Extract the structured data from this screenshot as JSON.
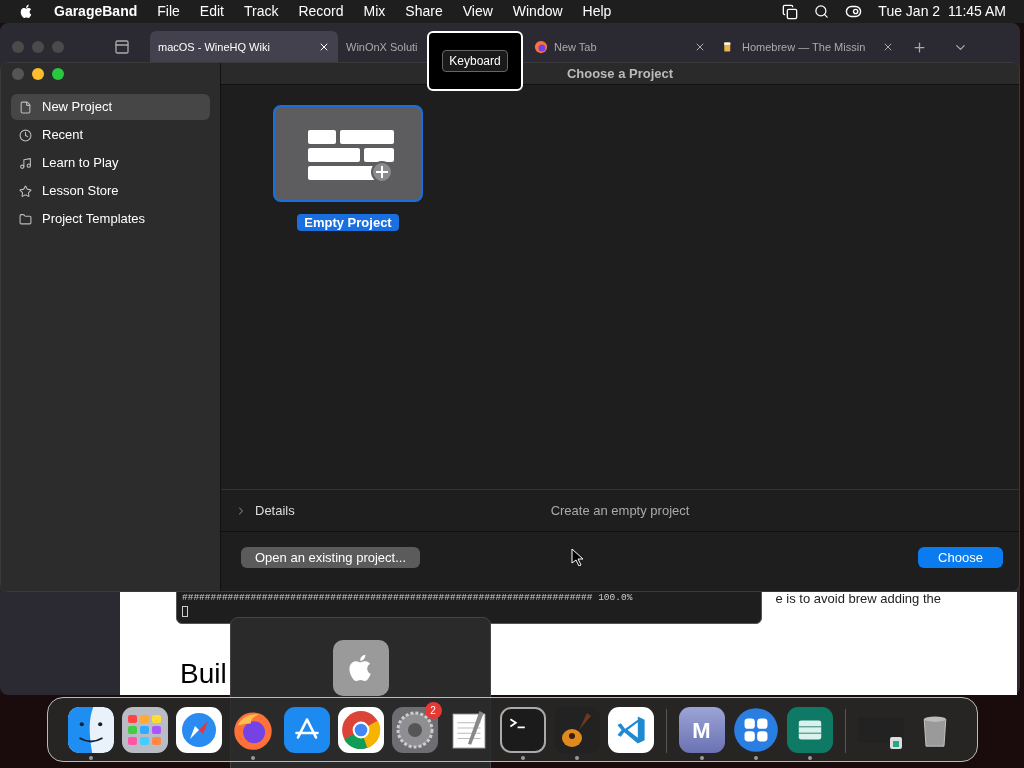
{
  "menu_bar": {
    "app": "GarageBand",
    "menus": [
      "File",
      "Edit",
      "Track",
      "Record",
      "Mix",
      "Share",
      "View",
      "Window",
      "Help"
    ],
    "date_time": "Tue Jan 2  11:45 AM"
  },
  "browser": {
    "tabs": [
      {
        "title": "macOS - WineHQ Wiki",
        "selected": true
      },
      {
        "title": "WinOnX Soluti",
        "selected": false
      },
      {
        "title": "New Tab",
        "selected": false
      },
      {
        "title": "Homebrew — The Missin",
        "selected": false
      }
    ],
    "page_text": "e is to avoid brew adding the",
    "heading": "Buil"
  },
  "tooltip": "Keyboard",
  "terminal": {
    "output": "######################################################################## 100.0%"
  },
  "garageband": {
    "title": "Choose a Project",
    "sidebar": [
      {
        "label": "New Project",
        "selected": true
      },
      {
        "label": "Recent",
        "selected": false
      },
      {
        "label": "Learn to Play",
        "selected": false
      },
      {
        "label": "Lesson Store",
        "selected": false
      },
      {
        "label": "Project Templates",
        "selected": false
      }
    ],
    "templates": [
      {
        "label": "Empty Project",
        "selected": true
      }
    ],
    "details": {
      "label": "Details",
      "expanded": false,
      "description": "Create an empty project"
    },
    "open_button": "Open an existing project...",
    "choose_button": "Choose"
  },
  "dock": {
    "apps": [
      {
        "kind": "finder",
        "running": true
      },
      {
        "kind": "launchpad",
        "running": false
      },
      {
        "kind": "safari",
        "running": false
      },
      {
        "kind": "firefox",
        "running": true
      },
      {
        "kind": "appstore",
        "running": false
      },
      {
        "kind": "chrome",
        "running": false
      },
      {
        "kind": "settings",
        "running": false,
        "badge": "2"
      },
      {
        "kind": "textedit",
        "running": false
      },
      {
        "kind": "terminal",
        "running": true
      },
      {
        "kind": "garageband",
        "running": true
      },
      {
        "kind": "vscode",
        "running": false
      },
      {
        "kind": "separator"
      },
      {
        "kind": "letter",
        "label": "M",
        "running": true
      },
      {
        "kind": "squares",
        "running": true
      },
      {
        "kind": "storage",
        "running": true
      },
      {
        "kind": "separator"
      },
      {
        "kind": "window",
        "running": false
      },
      {
        "kind": "trash",
        "running": false
      }
    ]
  }
}
